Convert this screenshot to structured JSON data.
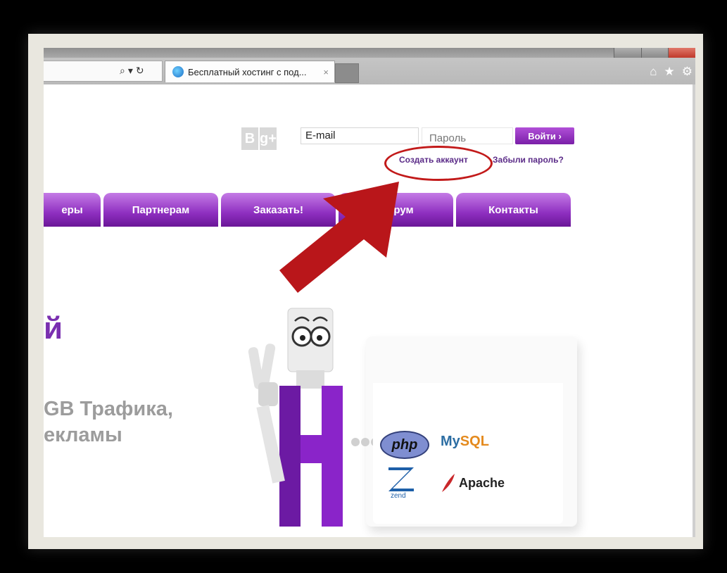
{
  "browser": {
    "tab_title": "Бесплатный хостинг с под...",
    "tab_close": "×",
    "addr_search": "⌕",
    "addr_dropdown": "▾",
    "addr_refresh": "↻",
    "home_icon": "⌂",
    "star_icon": "★",
    "gear_icon": "⚙"
  },
  "login": {
    "email_placeholder": "E-mail",
    "password_placeholder": "Пароль",
    "login_button": "Войти ›",
    "create_account": "Создать аккаунт",
    "forgot_password": "Забыли пароль?",
    "social": [
      "B",
      "g+"
    ]
  },
  "nav": {
    "items": [
      "еры",
      "Партнерам",
      "Заказать!",
      "Форум",
      "Контакты"
    ]
  },
  "hero": {
    "headline": "й",
    "line1": "GB Трафика,",
    "line2": "екламы"
  },
  "logos": {
    "php": "php",
    "mysql_a": "My",
    "mysql_b": "SQL",
    "zend": "zend",
    "apache": "Apache"
  },
  "colors": {
    "accent": "#8e2fc0",
    "annotation": "#c21a1a"
  }
}
